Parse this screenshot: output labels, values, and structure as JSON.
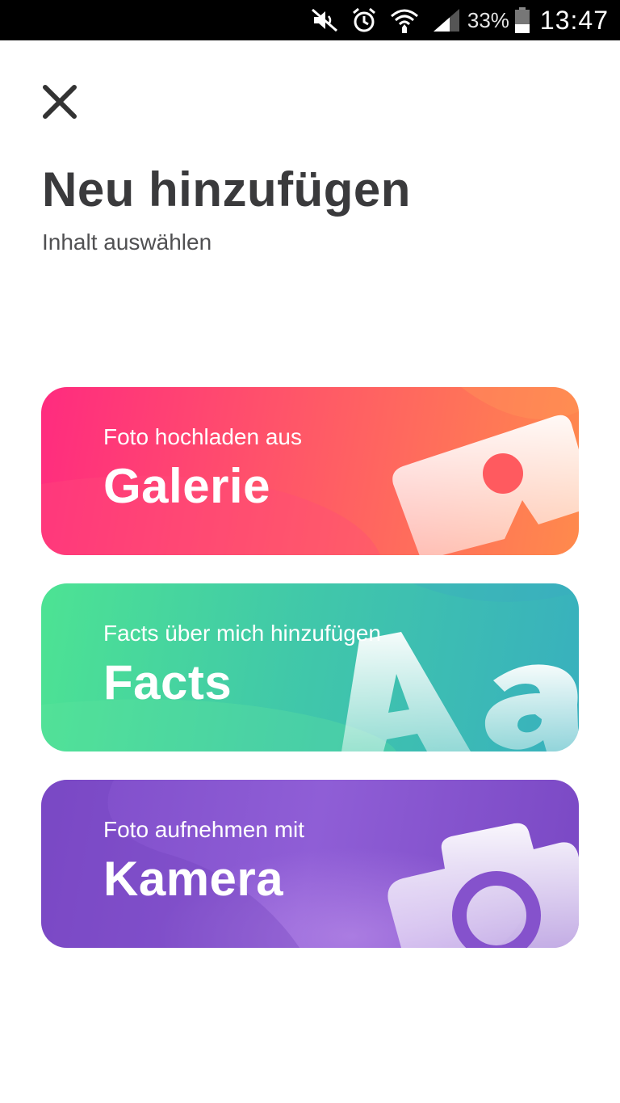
{
  "status_bar": {
    "icons": [
      "mute-icon",
      "alarm-icon",
      "wifi-icon",
      "signal-icon",
      "battery-icon"
    ],
    "battery_percent": "33%",
    "time": "13:47"
  },
  "header": {
    "close_icon": "close-icon",
    "title": "Neu hinzufügen",
    "subtitle": "Inhalt auswählen"
  },
  "cards": [
    {
      "subtitle": "Foto hochladen aus",
      "title": "Galerie",
      "icon": "gallery-photo-icon",
      "colors": [
        "#ff2b7f",
        "#ff8a4c"
      ]
    },
    {
      "subtitle": "Facts über mich hinzufügen",
      "title": "Facts",
      "icon": "text-aa-icon",
      "colors": [
        "#4de393",
        "#38b0be"
      ]
    },
    {
      "subtitle": "Foto aufnehmen mit",
      "title": "Kamera",
      "icon": "camera-icon",
      "colors": [
        "#7e4cc9",
        "#8f5ed6"
      ]
    }
  ]
}
